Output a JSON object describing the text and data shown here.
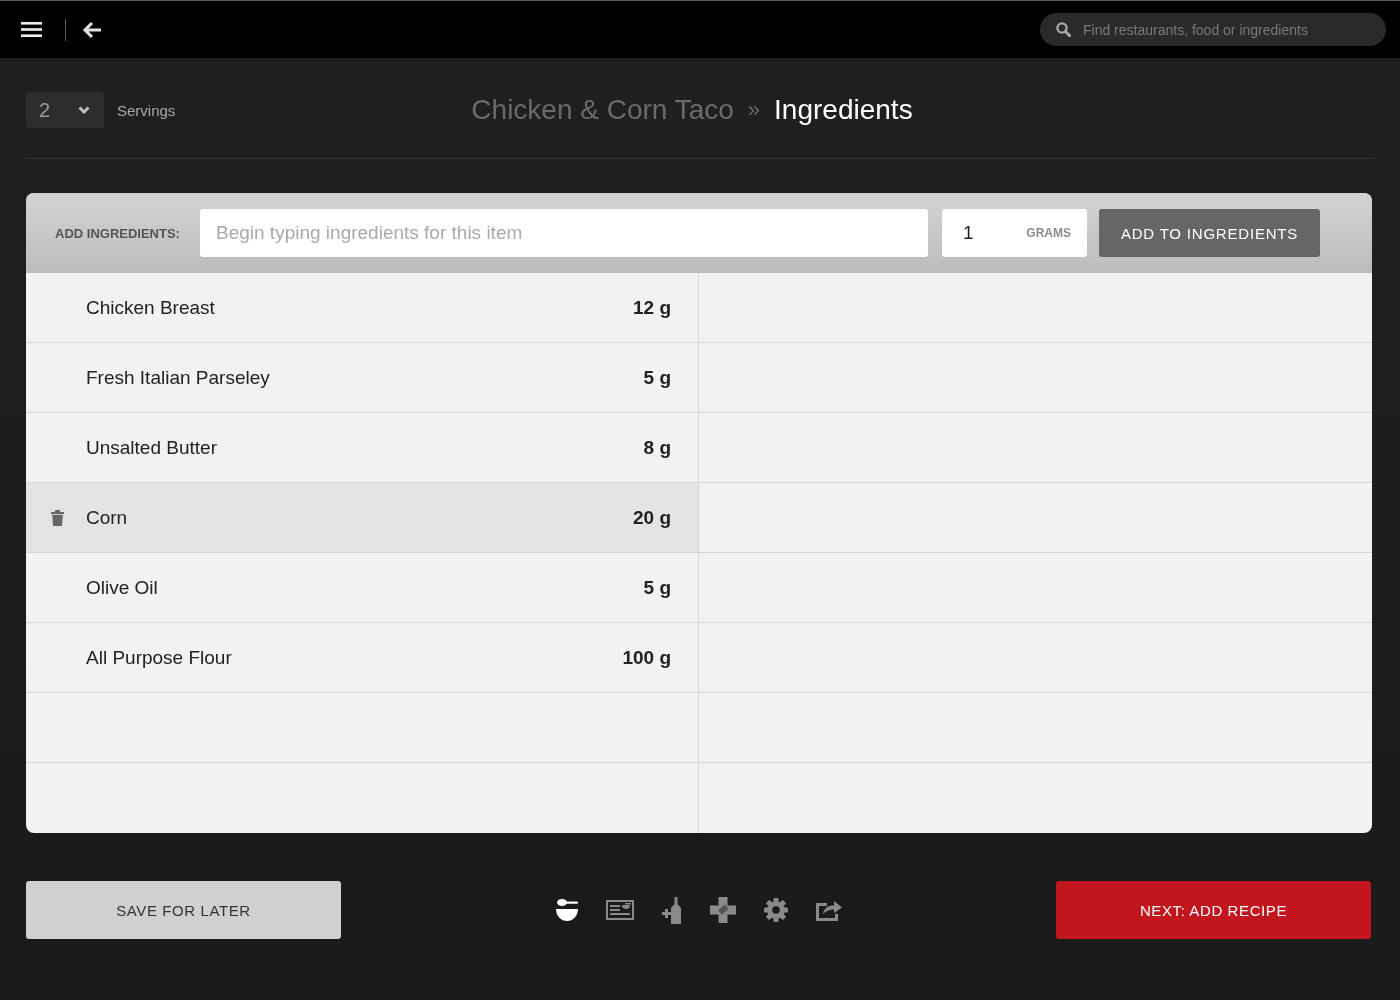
{
  "top_bar": {
    "search": {
      "placeholder": "Find restaurants, food or ingredients"
    }
  },
  "header": {
    "servings": {
      "value": "2",
      "label": "Servings"
    },
    "breadcrumb": [
      {
        "label": "Chicken & Corn Taco",
        "current": false
      },
      {
        "label": "Ingredients",
        "current": true
      }
    ],
    "separator": "»"
  },
  "add_ingredients": {
    "label": "ADD INGREDIENTS:",
    "ingredient_field": {
      "placeholder": "Begin typing ingredients for this item"
    },
    "quantity_field": {
      "value": "1",
      "unit": "GRAMS"
    },
    "button": "ADD TO INGREDIENTS"
  },
  "ingredients": {
    "rows": [
      {
        "name": "Chicken Breast",
        "amount": "12 g",
        "selected": false
      },
      {
        "name": "Fresh Italian Parseley",
        "amount": "5 g",
        "selected": false
      },
      {
        "name": "Unsalted Butter",
        "amount": "8 g",
        "selected": false
      },
      {
        "name": "Corn",
        "amount": "20 g",
        "selected": true
      },
      {
        "name": "Olive Oil",
        "amount": "5 g",
        "selected": false
      },
      {
        "name": "All Purpose Flour",
        "amount": "100 g",
        "selected": false
      }
    ]
  },
  "footer": {
    "save_button": "SAVE FOR LATER",
    "toolbar": [
      {
        "kind": "bowl",
        "selected": true
      },
      {
        "kind": "card",
        "selected": false
      },
      {
        "kind": "bottle",
        "selected": false
      },
      {
        "kind": "cross",
        "selected": false
      },
      {
        "kind": "gear",
        "selected": false
      },
      {
        "kind": "share",
        "selected": false
      }
    ],
    "next_button": "NEXT: ADD RECIPE"
  }
}
